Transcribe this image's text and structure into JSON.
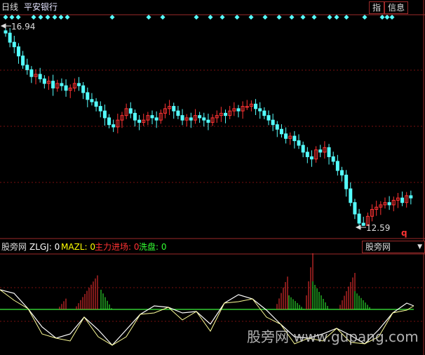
{
  "header": {
    "period": "日线",
    "stock": "平安银行",
    "btn_index": "指",
    "btn_info": "信息"
  },
  "price_panel": {
    "high_label": "16.94",
    "low_label": "12.59",
    "marker": "q"
  },
  "indicator_panel": {
    "name": "股旁网",
    "items": [
      {
        "text": "ZLGJ: 0",
        "color": "#ffffff"
      },
      {
        "text": "MAZL: 0",
        "color": "#ffff00"
      },
      {
        "text": "主力进场: 0",
        "color": "#ff3333"
      },
      {
        "text": "洗盘: 0",
        "color": "#33ff33"
      }
    ],
    "selector": "股旁网"
  },
  "watermark": "股旁网 www.gupang.com",
  "colors": {
    "up": "#ff3333",
    "down": "#54ffff",
    "grid": "#7a1010",
    "border": "#9c2a2a",
    "diamond": "#54ffff"
  },
  "chart_data": {
    "type": "candlestick",
    "high": 16.94,
    "low": 12.59,
    "closes": [
      16.8,
      16.6,
      16.5,
      16.3,
      16.1,
      16.0,
      15.85,
      15.9,
      15.8,
      15.7,
      15.75,
      15.6,
      15.7,
      15.65,
      15.55,
      15.6,
      15.7,
      15.65,
      15.5,
      15.35,
      15.3,
      15.2,
      15.1,
      14.95,
      14.8,
      14.75,
      14.9,
      15.0,
      15.15,
      15.05,
      14.9,
      14.85,
      14.9,
      15.0,
      14.95,
      14.9,
      15.05,
      15.15,
      15.2,
      15.1,
      15.0,
      14.9,
      14.95,
      14.9,
      15.0,
      14.95,
      14.9,
      14.85,
      14.95,
      15.0,
      15.05,
      15.0,
      15.1,
      15.15,
      15.1,
      15.2,
      15.2,
      15.25,
      15.15,
      15.1,
      15.0,
      14.9,
      14.8,
      14.7,
      14.6,
      14.5,
      14.55,
      14.45,
      14.35,
      14.2,
      14.1,
      14.05,
      14.25,
      14.2,
      14.3,
      14.1,
      14.0,
      13.8,
      13.7,
      13.4,
      13.1,
      12.85,
      12.65,
      12.6,
      12.8,
      12.95,
      13.0,
      13.05,
      13.1,
      13.05,
      13.15,
      13.2,
      13.1,
      13.25,
      13.2
    ]
  }
}
